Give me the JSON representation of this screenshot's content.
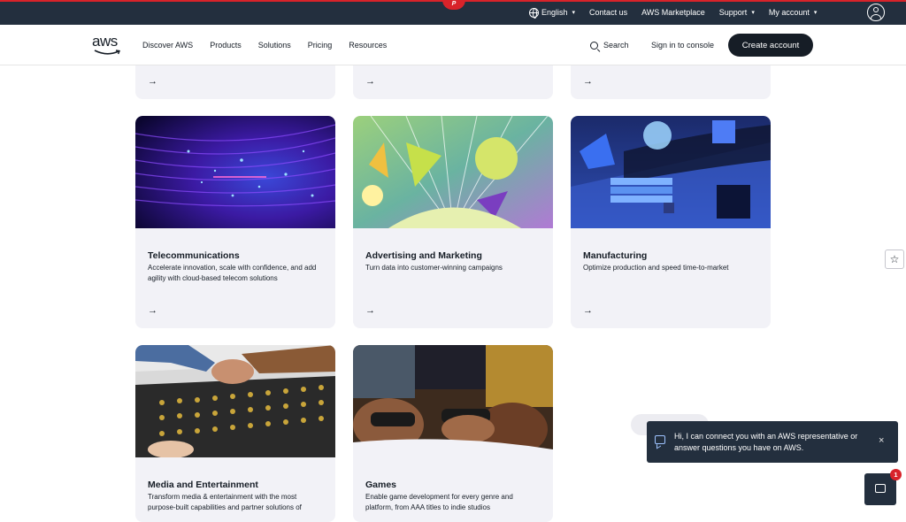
{
  "topbar": {
    "badge": "P",
    "language": "English",
    "contact": "Contact us",
    "marketplace": "AWS Marketplace",
    "support": "Support",
    "account": "My account"
  },
  "nav": {
    "logo": "aws",
    "links": [
      "Discover AWS",
      "Products",
      "Solutions",
      "Pricing",
      "Resources"
    ],
    "search": "Search",
    "signin": "Sign in to console",
    "create": "Create account"
  },
  "cards_top": [
    {
      "arrow": "→"
    },
    {
      "arrow": "→"
    },
    {
      "arrow": "→"
    }
  ],
  "cards": [
    {
      "title": "Telecommunications",
      "description": "Accelerate innovation, scale with confidence, and add agility with cloud-based telecom solutions",
      "arrow": "→"
    },
    {
      "title": "Advertising and Marketing",
      "description": "Turn data into customer-winning campaigns",
      "arrow": "→"
    },
    {
      "title": "Manufacturing",
      "description": "Optimize production and speed time-to-market",
      "arrow": "→"
    },
    {
      "title": "Media and Entertainment",
      "description": "Transform media & entertainment with the most purpose-built capabilities and partner solutions of",
      "arrow": "→"
    },
    {
      "title": "Games",
      "description": "Enable game development for every genre and platform, from AAA titles to indie studios",
      "arrow": "→"
    }
  ],
  "chat": {
    "message": "Hi, I can connect you with an AWS representative or answer questions you have on AWS.",
    "close": "×",
    "unread": "1"
  },
  "favorite": "☆"
}
